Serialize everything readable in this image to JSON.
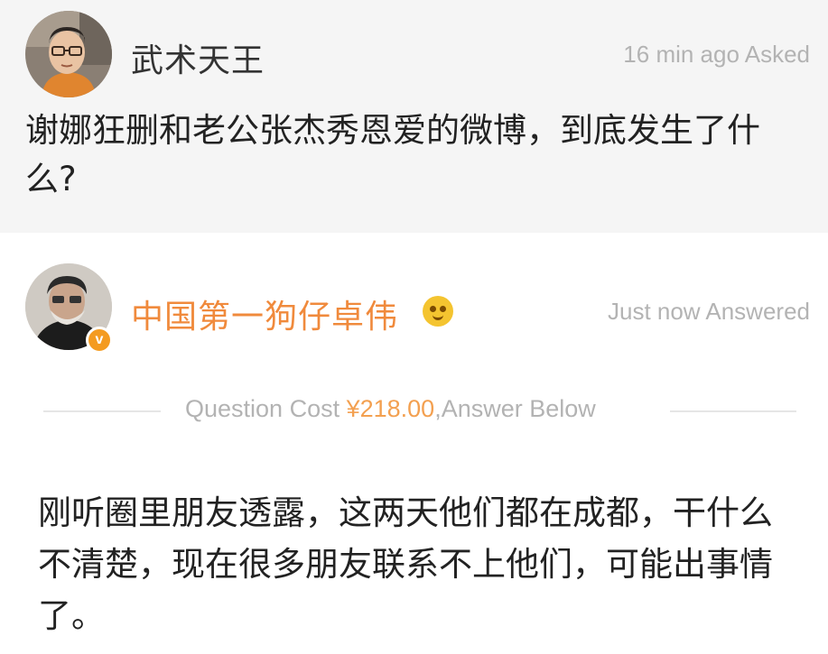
{
  "question": {
    "username": "武术天王",
    "meta": "16 min ago Asked",
    "text": "谢娜狂删和老公张杰秀恩爱的微博，到底发生了什么?"
  },
  "answer": {
    "username": "中国第一狗仔卓伟",
    "verified_badge": "v",
    "meta": "Just now Answered",
    "cost_prefix": "Question Cost ",
    "cost_amount": "¥218.00",
    "cost_suffix": ",Answer Below",
    "text": "刚听圈里朋友透露，这两天他们都在成都，干什么不清楚，现在很多朋友联系不上他们，可能出事情了。"
  },
  "colors": {
    "question_bg": "#f5f5f5",
    "answer_bg": "#ffffff",
    "answerer_name": "#f08a3c",
    "cost_amount": "#f3a050",
    "meta_gray": "#b3b3b3"
  },
  "icons": {
    "verified": "verified-v-icon",
    "emoji": "grin-face-emoji-icon"
  }
}
